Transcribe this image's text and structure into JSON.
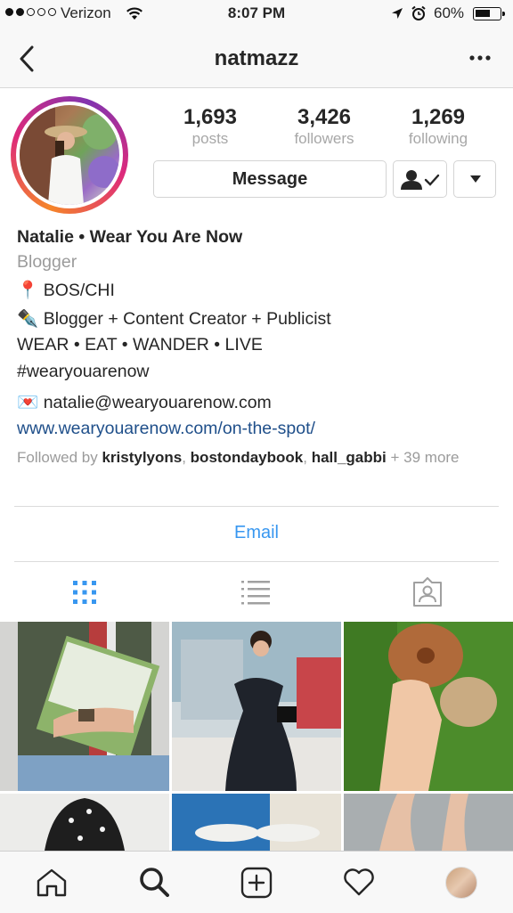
{
  "status_bar": {
    "carrier": "Verizon",
    "time": "8:07 PM",
    "battery_percent": "60%",
    "battery_level": 0.6
  },
  "nav": {
    "title": "natmazz",
    "back_icon": "chevron-left-icon",
    "more_icon": "ellipsis-icon"
  },
  "profile": {
    "stats": [
      {
        "value": "1,693",
        "label": "posts"
      },
      {
        "value": "3,426",
        "label": "followers"
      },
      {
        "value": "1,269",
        "label": "following"
      }
    ],
    "message_label": "Message",
    "name": "Natalie • Wear You Are Now",
    "category": "Blogger",
    "bio": [
      {
        "emoji": "📍",
        "text": "BOS/CHI"
      },
      {
        "emoji": "✒️",
        "text": "Blogger + Content Creator + Publicist"
      },
      {
        "emoji": "",
        "text": "WEAR • EAT • WANDER • LIVE"
      },
      {
        "emoji": "",
        "text": "#wearyouarenow"
      },
      {
        "emoji": "💌",
        "text": "natalie@wearyouarenow.com"
      }
    ],
    "link": "www.wearyouarenow.com/on-the-spot/",
    "followed_by": {
      "prefix": "Followed by",
      "users": [
        "kristylyons",
        "bostondaybook",
        "hall_gabbi"
      ],
      "suffix": "+ 39 more"
    },
    "email_button": "Email"
  },
  "view_tabs": [
    "grid-icon",
    "list-icon",
    "tagged-icon"
  ],
  "tab_bar": [
    "home-icon",
    "search-icon",
    "add-icon",
    "heart-icon",
    "profile-avatar"
  ],
  "colors": {
    "link": "#1f4f8a",
    "accent_blue": "#3897f0",
    "secondary_text": "#9b9b9b"
  }
}
